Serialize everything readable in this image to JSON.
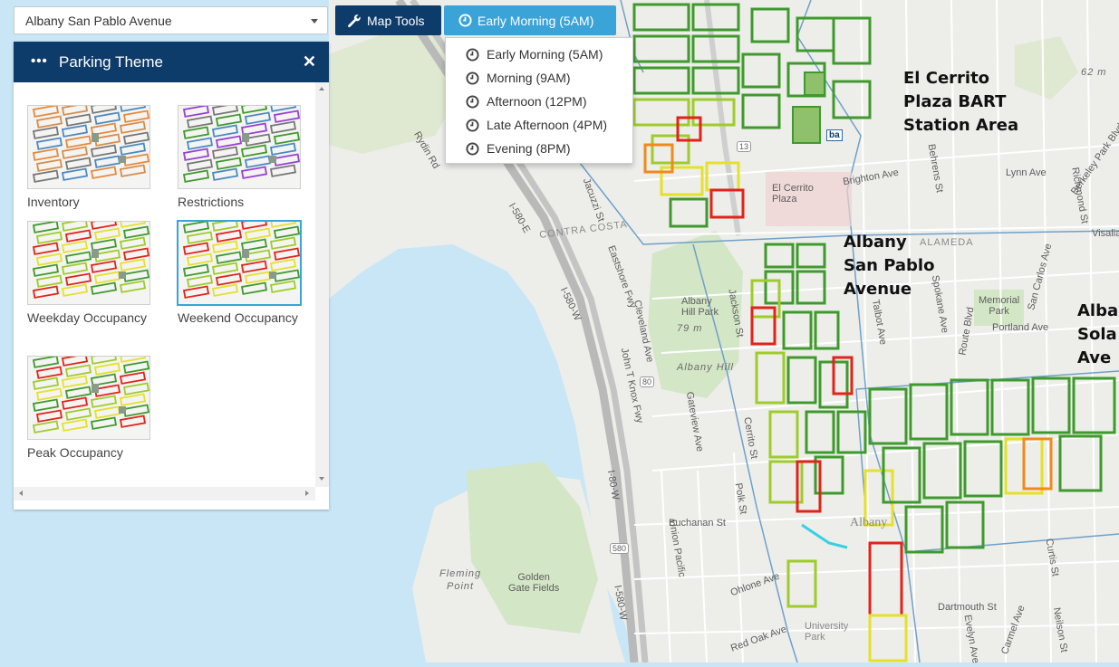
{
  "area_select": {
    "value": "Albany San Pablo Avenue"
  },
  "toolbar": {
    "map_tools_label": "Map Tools",
    "time_label": "Early Morning (5AM)"
  },
  "time_menu": {
    "items": [
      {
        "label": "Early Morning (5AM)"
      },
      {
        "label": "Morning (9AM)"
      },
      {
        "label": "Afternoon (12PM)"
      },
      {
        "label": "Late Afternoon (4PM)"
      },
      {
        "label": "Evening (8PM)"
      }
    ]
  },
  "panel": {
    "title": "Parking Theme",
    "themes": [
      {
        "label": "Inventory",
        "palette": "inventory"
      },
      {
        "label": "Restrictions",
        "palette": "restrictions"
      },
      {
        "label": "Weekday Occupancy",
        "palette": "occupancy"
      },
      {
        "label": "Weekend Occupancy",
        "palette": "occupancy",
        "selected": true
      },
      {
        "label": "Peak Occupancy",
        "palette": "peak"
      }
    ]
  },
  "map": {
    "area_labels": {
      "el_cerrito": "El Cerrito\nPlaza BART\nStation Area",
      "albany_sp": "Albany\nSan Pablo\nAvenue",
      "albany_solano": "Alba\nSola\nAve"
    },
    "places": {
      "el_cerrito_plaza": "El Cerrito\nPlaza",
      "albany_hill": "Albany\nHill Park",
      "albany_hill_elev": "79 m",
      "albany_hill_ital": "Albany Hill",
      "memorial_park": "Memorial\nPark",
      "golden_gate_fields": "Golden\nGate Fields",
      "fleming_point": "Fleming\nPoint",
      "contra_costa": "CONTRA COSTA",
      "alameda": "ALAMEDA",
      "albany_city": "Albany",
      "elev_62": "62 m",
      "university_park": "University\nPark",
      "bart_logo": "ba"
    },
    "streets": {
      "rydin": "Rydin Rd",
      "i580e": "I-580-E",
      "i580w": "I-580-W",
      "i580w2": "I-580-W",
      "i80w": "I-80-W",
      "jacuzzi": "Jacuzzi St",
      "eastshore": "Eastshore Fwy",
      "john_knox": "John T Knox Fwy",
      "cleveland": "Cleveland Ave",
      "gateview": "Gateview Ave",
      "jackson": "Jackson St",
      "cerrito": "Cerrito St",
      "polk": "Polk St",
      "buchanan": "Buchanan St",
      "union_pacific": "Union Pacific",
      "ohlone": "Ohlone Ave",
      "red_oak": "Red Oak Ave",
      "talbot": "Talbot Ave",
      "spokane": "Spokane Ave",
      "portland": "Portland Ave",
      "lynn": "Lynn Ave",
      "behrens": "Behrens St",
      "berkeley_park": "Berkeley Park Blvd",
      "san_carlos": "San Carlos Ave",
      "curtis": "Curtis St",
      "dartmouth": "Dartmouth St",
      "carmel": "Carmel Ave",
      "evelyn": "Evelyn Ave",
      "neilson": "Neilson St",
      "richmond": "Richmond St",
      "route_blvd": "Route Blvd",
      "brighton": "Brighton Ave",
      "visalia": "Visalia",
      "i80": "80",
      "i580": "580",
      "r13": "13"
    }
  }
}
